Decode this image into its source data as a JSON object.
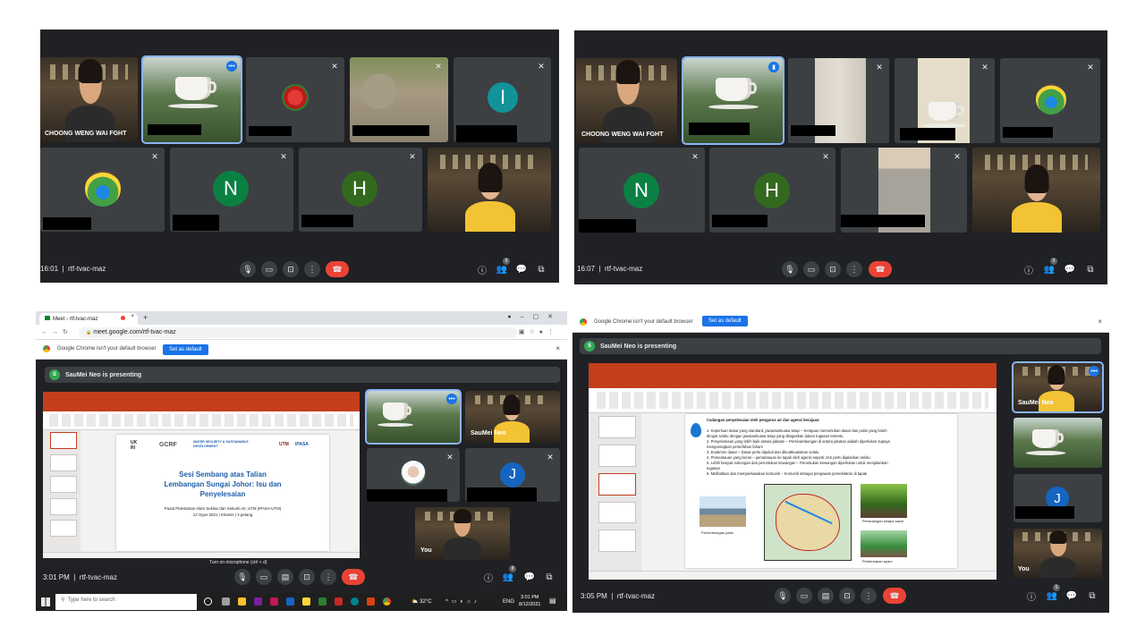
{
  "q1": {
    "time": "16:01",
    "meeting_code": "rtf-tvac-maz",
    "name_choong": "CHOONG WENG WAI FGHT",
    "avatar_i": "I",
    "avatar_n": "N",
    "avatar_h": "H",
    "participants_count": "9"
  },
  "q2": {
    "time": "16:07",
    "meeting_code": "rtf-tvac-maz",
    "name_choong": "CHOONG WENG WAI FGHT",
    "avatar_n": "N",
    "avatar_h": "H",
    "participants_count": "9"
  },
  "q3": {
    "tab_title": "Meet - rtf-tvac-maz",
    "url": "meet.google.com/rtf-tvac-maz",
    "infobar_text": "Google Chrome isn't your default browser",
    "set_default": "Set as default",
    "presenting_initial": "S",
    "presenting_text": "SauMei Neo is presenting",
    "slide": {
      "logos": [
        "UK RI",
        "GCRF",
        "WATER SECURITY & SUSTAINABLE DEVELOPMENT",
        "UTM",
        "IPASA"
      ],
      "title_lines": [
        "Sesi Sembang atas Talian",
        "Lembangan Sungai Johor: Isu dan",
        "Penyelesaian"
      ],
      "sub1": "Pusat Pelestarian Alam Sekitar dan Sekuriti Air, UTM (IPASA-UTM)",
      "sub2": "12 Ogos 2021 | Khamis | 3 petang"
    },
    "name_saumei": "SauMei Neo",
    "name_you": "You",
    "avatar_j": "J",
    "tooltip": "Turn on microphone (ctrl + d)",
    "time": "3:01 PM",
    "meeting_code": "rtf-tvac-maz",
    "participants_count": "8",
    "taskbar_search": "Type here to search",
    "temp": "32°C",
    "lang": "ENG",
    "clock_time": "3:01 PM",
    "clock_date": "8/12/2021"
  },
  "q4": {
    "infobar_text": "Google Chrome isn't your default browser",
    "set_default": "Set as default",
    "presenting_initial": "S",
    "presenting_text": "SauMei Neo is presenting",
    "slide": {
      "heading": "Cadangan penyelesaian oleh pengurus air dan agensi kerajaan:",
      "items": [
        "1.  Keperluan dasar yang standard, jawantankuasa tetap – Kerajaan memerlukan dasar dan polisi yang boleh",
        "     dirujuk selalu dengan jawatankuasa tetap yang ditugaskan dalam tugasan tertentu",
        "2.  Penyelarasan yang lebih baik antara jabatan – Persinambungan di antara jabatan adalah diperlukan supaya",
        "     mengurangkan persefahan faham",
        "3.  Enakmen dasar – Dasar perlu dipukal dan dikuatkuasakan selalu",
        "4.  Pemantauan yang keras – pemantauan ke tapak oleh agensi seperti JAS perlu dijalankan selalu",
        "5.  Lebih banyak sokongan dan peruntukan kewangan – Peruntukan kewangan diperlukan untuk menjalankan",
        "     tugasan",
        "6.  Melibatkan dan memperkasakan komuniti – Komuniti sebagai pengawas persekitaran di tapak"
      ],
      "caption_left": "Perlombongan pasir",
      "caption_right_top": "Perladangan kelapa sawit",
      "caption_right_bottom": "Penternakan ayam"
    },
    "name_saumei": "SauMei Neo",
    "name_you": "You",
    "avatar_j": "J",
    "time": "3:05 PM",
    "meeting_code": "rtf-tvac-maz",
    "participants_count": "5"
  },
  "colors": {
    "meet_bg": "#202124",
    "tile_bg": "#3c4043",
    "end_call": "#ea4335",
    "avatar_i": "#12939a",
    "avatar_n": "#0b8043",
    "avatar_h": "#33691e",
    "avatar_j": "#1565c0",
    "ppt_accent": "#c43e1c"
  },
  "icons": [
    "mic-icon",
    "camera-icon",
    "captions-icon",
    "present-icon",
    "more-icon",
    "end-call-icon",
    "info-icon",
    "people-icon",
    "chat-icon",
    "activities-icon",
    "mic-off-icon"
  ]
}
